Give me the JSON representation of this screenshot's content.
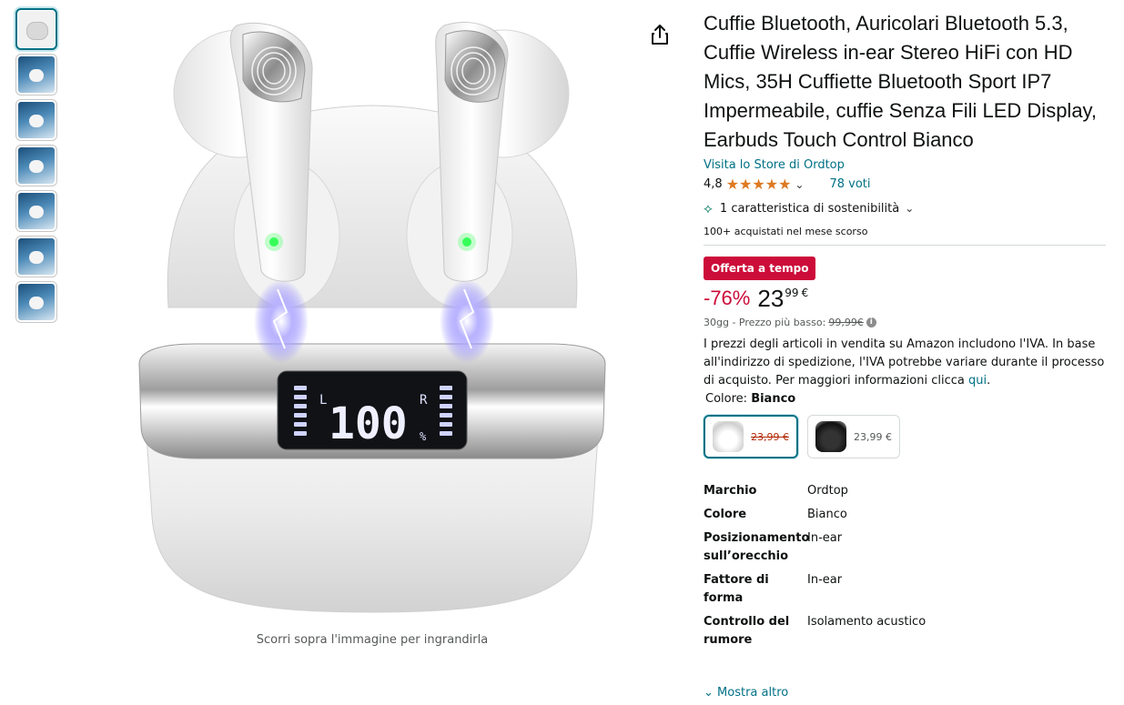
{
  "thumbnails": [
    {
      "kind": "product"
    },
    {
      "kind": "feature"
    },
    {
      "kind": "feature"
    },
    {
      "kind": "feature"
    },
    {
      "kind": "feature"
    },
    {
      "kind": "feature"
    },
    {
      "kind": "feature"
    }
  ],
  "main_image": {
    "display": {
      "left_label": "L",
      "right_label": "R",
      "value": "100",
      "unit": "%"
    },
    "caption": "Scorri sopra l'immagine per ingrandirla"
  },
  "share_icon": "share-icon",
  "product": {
    "title": "Cuffie Bluetooth, Auricolari Bluetooth 5.3, Cuffie Wireless in-ear Stereo HiFi con HD Mics, 35H Cuffiette Bluetooth Sport IP7 Impermeabile, cuffie Senza Fili LED Display, Earbuds Touch Control Bianco",
    "store_link": "Visita lo Store di Ordtop",
    "rating": "4,8",
    "stars": "★★★★★",
    "votes": "78 voti",
    "sustainability": "1 caratteristica di sostenibilità",
    "bought": "100+ acquistati nel mese scorso"
  },
  "price": {
    "deal_badge": "Offerta a tempo",
    "discount": "-76%",
    "whole": "23",
    "fraction": "99",
    "currency": "€",
    "lowest_label": "30gg - Prezzo più basso:",
    "lowest_value": "99,99€",
    "vat_text": "I prezzi degli articoli in vendita su Amazon includono l'IVA. In base all'indirizzo di spedizione, l'IVA potrebbe variare durante il processo di acquisto. Per maggiori informazioni clicca ",
    "vat_link": "qui",
    "vat_end": "."
  },
  "color": {
    "label": "Colore:",
    "selected": "Bianco",
    "options": [
      {
        "name": "Bianco",
        "price": "23,99 €"
      },
      {
        "name": "Nero",
        "price": "23,99 €"
      }
    ]
  },
  "specs": [
    {
      "key": "Marchio",
      "value": "Ordtop"
    },
    {
      "key": "Colore",
      "value": "Bianco"
    },
    {
      "key": "Posizionamento sull’orecchio",
      "value": "In-ear"
    },
    {
      "key": "Fattore di forma",
      "value": "In-ear"
    },
    {
      "key": "Controllo del rumore",
      "value": "Isolamento acustico"
    }
  ],
  "show_more": "Mostra altro",
  "colors": {
    "link": "#007185",
    "deal": "#cc0c39",
    "star": "#de7921"
  }
}
